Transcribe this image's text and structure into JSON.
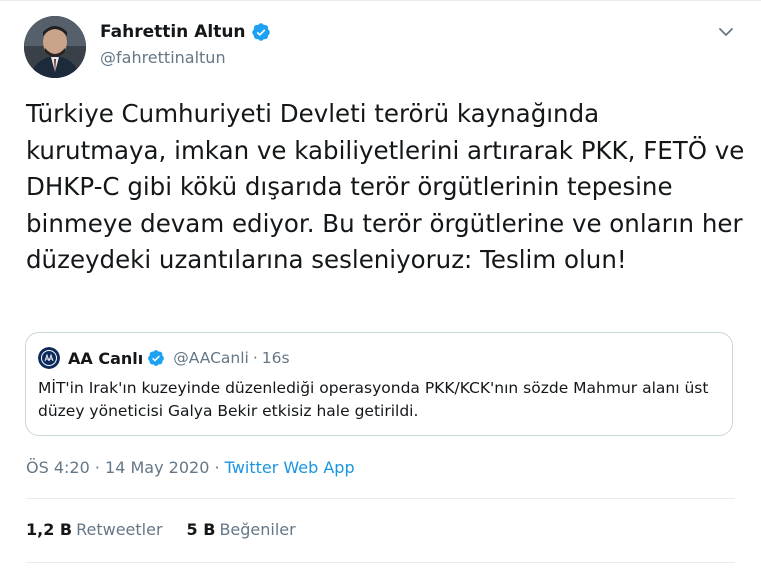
{
  "author": {
    "name": "Fahrettin Altun",
    "handle": "@fahrettinaltun",
    "verified": true
  },
  "tweet": {
    "text": "Türkiye Cumhuriyeti Devleti terörü kaynağında kurutmaya, imkan ve kabiliyetlerini artırarak PKK, FETÖ ve DHKP-C gibi kökü dışarıda terör örgütlerinin tepesine binmeye devam ediyor. Bu terör örgütlerine ve onların her düzeydeki uzantılarına sesleniyoruz: Teslim olun!"
  },
  "quoted": {
    "name": "AA Canlı",
    "handle": "@AACanli",
    "separator": "·",
    "time": "16s",
    "verified": true,
    "text": "MİT'in Irak'ın kuzeyinde düzenlediği operasyonda PKK/KCK'nın sözde Mahmur alanı üst düzey yöneticisi Galya Bekir etkisiz hale getirildi."
  },
  "meta": {
    "time": "ÖS 4:20",
    "separator1": "·",
    "date": "14 May 2020",
    "separator2": "·",
    "source": "Twitter Web App"
  },
  "stats": {
    "retweets_count": "1,2 B",
    "retweets_label": "Retweetler",
    "likes_count": "5 B",
    "likes_label": "Beğeniler"
  },
  "icons": {
    "verified": "verified-badge-icon",
    "caret": "chevron-down-icon",
    "quoted_logo": "aa-logo-icon"
  },
  "colors": {
    "accent": "#1da1f2",
    "link": "#1b95e0",
    "secondary_text": "#657786",
    "border": "#ccd6dd"
  }
}
